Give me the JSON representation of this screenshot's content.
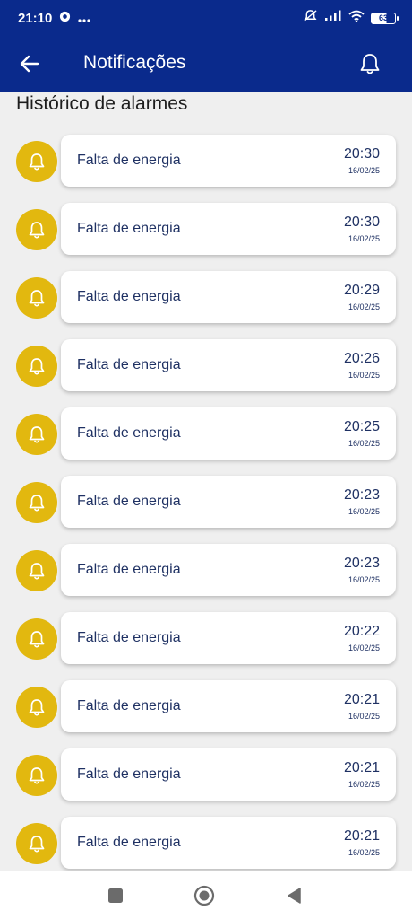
{
  "status_bar": {
    "time": "21:10",
    "battery": "63"
  },
  "app_bar": {
    "title": "Notificações"
  },
  "section": {
    "title": "Histórico de alarmes"
  },
  "alarms": [
    {
      "label": "Falta de energia",
      "time": "20:30",
      "date": "16/02/25"
    },
    {
      "label": "Falta de energia",
      "time": "20:30",
      "date": "16/02/25"
    },
    {
      "label": "Falta de energia",
      "time": "20:29",
      "date": "16/02/25"
    },
    {
      "label": "Falta de energia",
      "time": "20:26",
      "date": "16/02/25"
    },
    {
      "label": "Falta de energia",
      "time": "20:25",
      "date": "16/02/25"
    },
    {
      "label": "Falta de energia",
      "time": "20:23",
      "date": "16/02/25"
    },
    {
      "label": "Falta de energia",
      "time": "20:23",
      "date": "16/02/25"
    },
    {
      "label": "Falta de energia",
      "time": "20:22",
      "date": "16/02/25"
    },
    {
      "label": "Falta de energia",
      "time": "20:21",
      "date": "16/02/25"
    },
    {
      "label": "Falta de energia",
      "time": "20:21",
      "date": "16/02/25"
    },
    {
      "label": "Falta de energia",
      "time": "20:21",
      "date": "16/02/25"
    }
  ],
  "colors": {
    "primary": "#0a2a8c",
    "alarm_icon": "#e2b80f",
    "text": "#1f3163"
  },
  "icons": {
    "back": "arrow-left-icon",
    "notifications": "bell-outline-icon",
    "alarm": "bell-icon",
    "nav_recent": "square-icon",
    "nav_home": "circle-icon",
    "nav_back": "triangle-back-icon"
  }
}
